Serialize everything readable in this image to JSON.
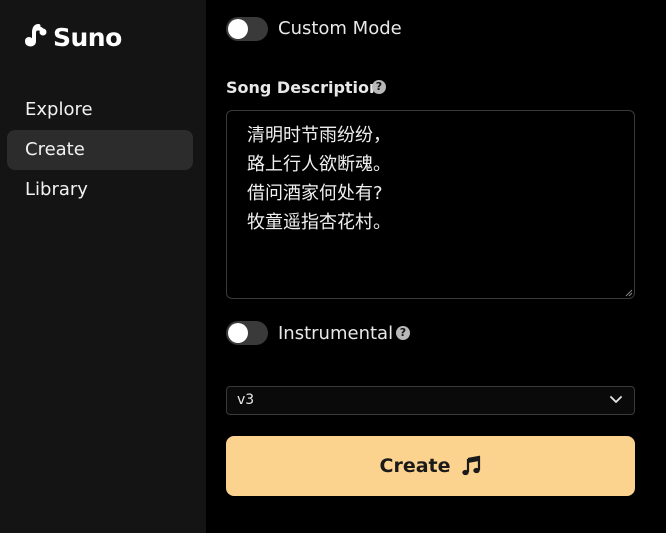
{
  "sidebar": {
    "brand": "Suno",
    "items": [
      {
        "label": "Explore",
        "active": false
      },
      {
        "label": "Create",
        "active": true
      },
      {
        "label": "Library",
        "active": false
      }
    ]
  },
  "form": {
    "custom_mode": {
      "label": "Custom Mode",
      "enabled": false
    },
    "description": {
      "label": "Song Description",
      "help_icon": "question-circle-icon",
      "value": "清明时节雨纷纷，\n路上行人欲断魂。\n借问酒家何处有?\n牧童遥指杏花村。"
    },
    "instrumental": {
      "label": "Instrumental",
      "enabled": false,
      "help_icon": "question-circle-icon"
    },
    "model_select": {
      "value": "v3",
      "icon": "chevron-down-icon"
    },
    "create_button": {
      "label": "Create",
      "icon": "music-note-icon"
    }
  },
  "colors": {
    "sidebar_bg": "#141414",
    "active_nav_bg": "#2c2c2c",
    "accent_button": "#fcd28f",
    "main_bg": "#000000"
  }
}
